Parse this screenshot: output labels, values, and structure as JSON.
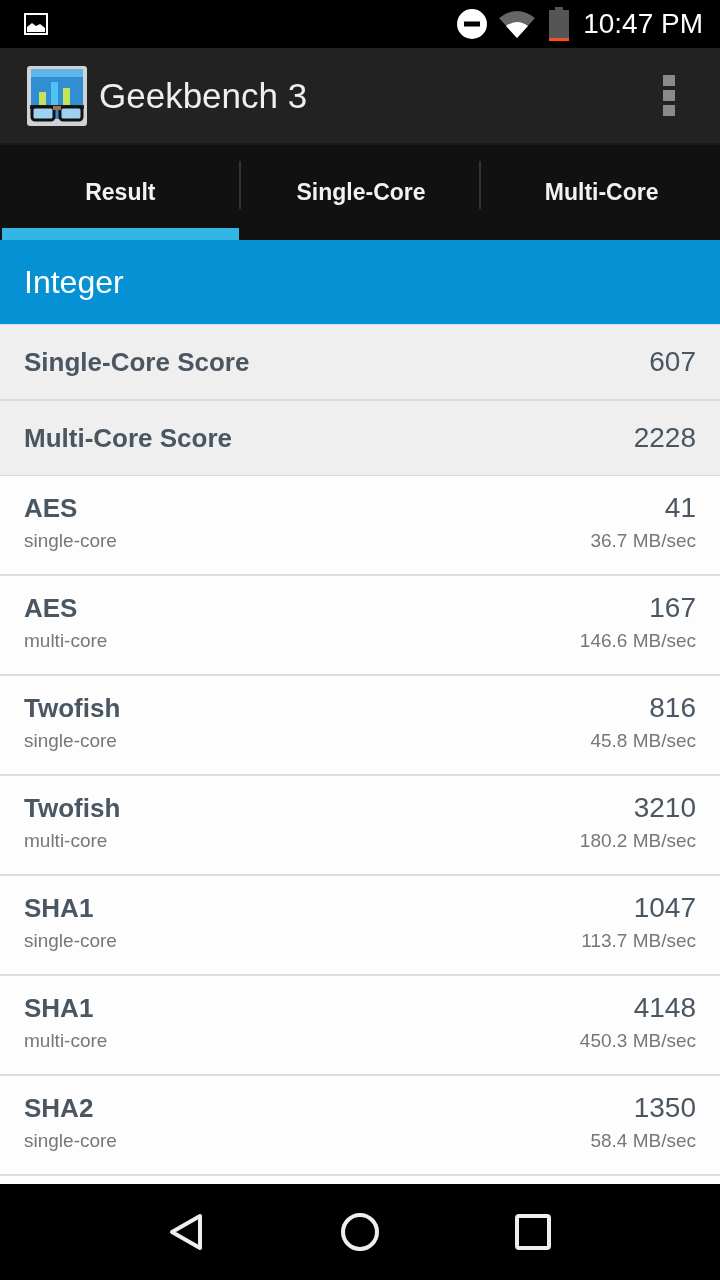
{
  "status_bar": {
    "time": "10:47 PM"
  },
  "app_bar": {
    "title": "Geekbench 3"
  },
  "tabs": [
    {
      "label": "Result",
      "selected": true
    },
    {
      "label": "Single-Core",
      "selected": false
    },
    {
      "label": "Multi-Core",
      "selected": false
    }
  ],
  "section": {
    "title": "Integer"
  },
  "scores": [
    {
      "label": "Single-Core Score",
      "value": "607"
    },
    {
      "label": "Multi-Core Score",
      "value": "2228"
    }
  ],
  "results": [
    {
      "name": "AES",
      "mode": "single-core",
      "score": "41",
      "rate": "36.7 MB/sec"
    },
    {
      "name": "AES",
      "mode": "multi-core",
      "score": "167",
      "rate": "146.6 MB/sec"
    },
    {
      "name": "Twofish",
      "mode": "single-core",
      "score": "816",
      "rate": "45.8 MB/sec"
    },
    {
      "name": "Twofish",
      "mode": "multi-core",
      "score": "3210",
      "rate": "180.2 MB/sec"
    },
    {
      "name": "SHA1",
      "mode": "single-core",
      "score": "1047",
      "rate": "113.7 MB/sec"
    },
    {
      "name": "SHA1",
      "mode": "multi-core",
      "score": "4148",
      "rate": "450.3 MB/sec"
    },
    {
      "name": "SHA2",
      "mode": "single-core",
      "score": "1350",
      "rate": "58.4 MB/sec"
    }
  ]
}
